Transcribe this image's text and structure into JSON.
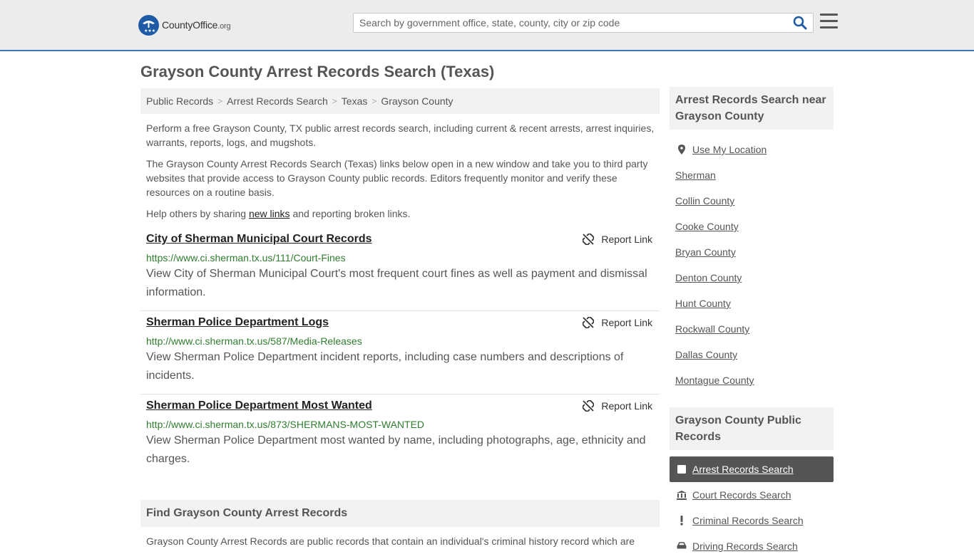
{
  "header": {
    "logo_main": "CountyOffice",
    "logo_tld": ".org",
    "search_placeholder": "Search by government office, state, county, city or zip code"
  },
  "page": {
    "title": "Grayson County Arrest Records Search (Texas)"
  },
  "breadcrumb": [
    "Public Records",
    "Arrest Records Search",
    "Texas",
    "Grayson County"
  ],
  "intro": {
    "p1": "Perform a free Grayson County, TX public arrest records search, including current & recent arrests, arrest inquiries, warrants, reports, logs, and mugshots.",
    "p2": "The Grayson County Arrest Records Search (Texas) links below open in a new window and take you to third party websites that provide access to Grayson County public records. Editors frequently monitor and verify these resources on a routine basis.",
    "p3_before": "Help others by sharing ",
    "p3_link": "new links",
    "p3_after": " and reporting broken links."
  },
  "entries": [
    {
      "title": "City of Sherman Municipal Court Records",
      "url": "https://www.ci.sherman.tx.us/111/Court-Fines",
      "description": "View City of Sherman Municipal Court's most frequent court fines as well as payment and dismissal information.",
      "report_label": "Report Link"
    },
    {
      "title": "Sherman Police Department Logs",
      "url": "http://www.ci.sherman.tx.us/587/Media-Releases",
      "description": "View Sherman Police Department incident reports, including case numbers and descriptions of incidents.",
      "report_label": "Report Link"
    },
    {
      "title": "Sherman Police Department Most Wanted",
      "url": "http://www.ci.sherman.tx.us/873/SHERMANS-MOST-WANTED",
      "description": "View Sherman Police Department most wanted by name, including photographs, age, ethnicity and charges.",
      "report_label": "Report Link"
    }
  ],
  "find_section": {
    "heading": "Find Grayson County Arrest Records",
    "text": "Grayson County Arrest Records are public records that contain an individual's criminal history record which are"
  },
  "sidebar": {
    "nearby_heading": "Arrest Records Search near Grayson County",
    "use_location": "Use My Location",
    "nearby": [
      "Sherman",
      "Collin County",
      "Cooke County",
      "Bryan County",
      "Denton County",
      "Hunt County",
      "Rockwall County",
      "Dallas County",
      "Montague County"
    ],
    "public_heading": "Grayson County Public Records",
    "public_records": [
      {
        "label": "Arrest Records Search",
        "icon": "square-icon"
      },
      {
        "label": "Court Records Search",
        "icon": "courthouse-icon"
      },
      {
        "label": "Criminal Records Search",
        "icon": "exclamation-icon"
      },
      {
        "label": "Driving Records Search",
        "icon": "car-icon"
      }
    ]
  },
  "colors": {
    "accent": "#3f76b5",
    "url_green": "#2f7d2f",
    "active_bg": "#555555"
  }
}
